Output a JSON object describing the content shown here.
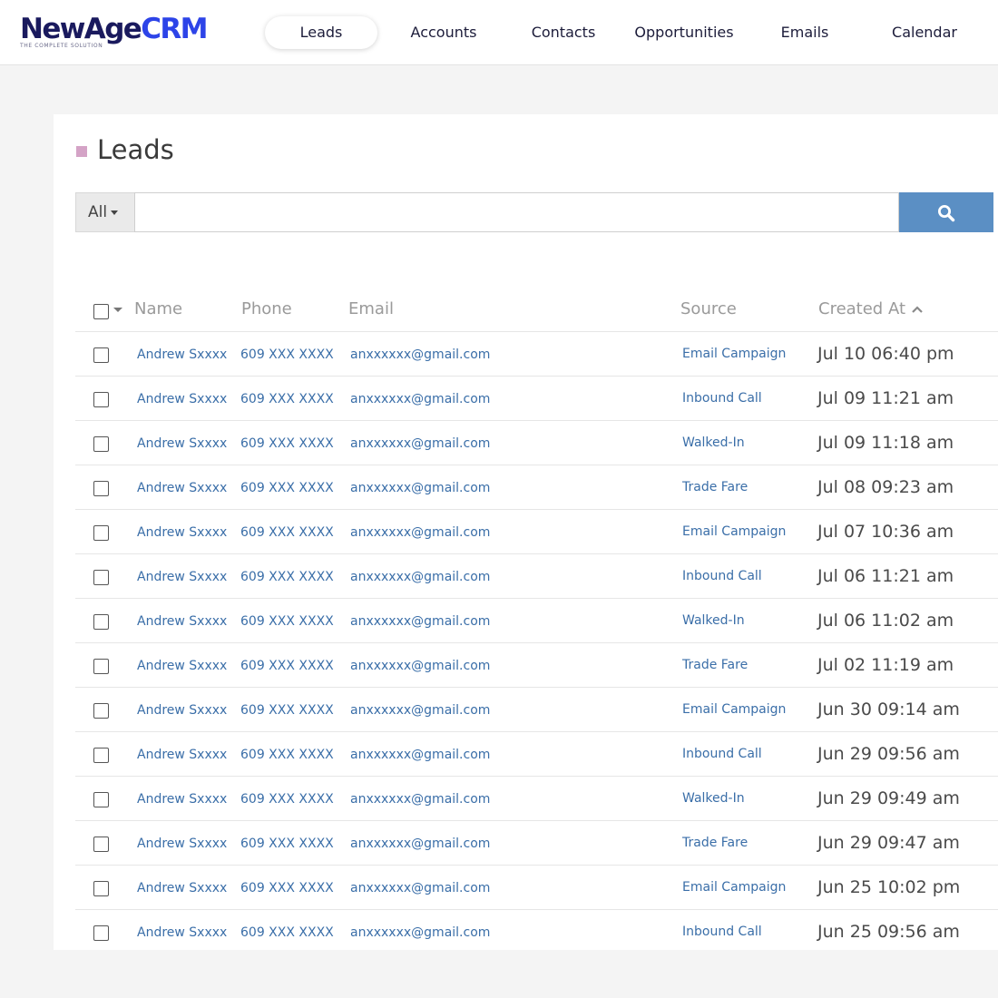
{
  "logo": {
    "part1": "NewAge",
    "part2": "CRM",
    "tagline": "THE COMPLETE SOLUTION"
  },
  "nav": [
    {
      "label": "Leads",
      "active": true
    },
    {
      "label": "Accounts",
      "active": false
    },
    {
      "label": "Contacts",
      "active": false
    },
    {
      "label": "Opportunities",
      "active": false
    },
    {
      "label": "Emails",
      "active": false
    },
    {
      "label": "Calendar",
      "active": false
    }
  ],
  "page": {
    "title": "Leads"
  },
  "search": {
    "filter_label": "All",
    "value": "",
    "placeholder": "",
    "button_icon": "search-icon"
  },
  "table": {
    "headers": {
      "name": "Name",
      "phone": "Phone",
      "email": "Email",
      "source": "Source",
      "created_at": "Created At"
    },
    "sort": {
      "column": "created_at",
      "direction": "asc",
      "icon": "chevron-up-icon"
    },
    "rows": [
      {
        "name": "Andrew Sxxxx",
        "phone": "609 XXX XXXX",
        "email": "anxxxxxx@gmail.com",
        "source": "Email Campaign",
        "created_at": "Jul 10 06:40 pm"
      },
      {
        "name": "Andrew Sxxxx",
        "phone": "609 XXX XXXX",
        "email": "anxxxxxx@gmail.com",
        "source": "Inbound Call",
        "created_at": "Jul 09 11:21 am"
      },
      {
        "name": "Andrew Sxxxx",
        "phone": "609 XXX XXXX",
        "email": "anxxxxxx@gmail.com",
        "source": "Walked-In",
        "created_at": "Jul 09 11:18 am"
      },
      {
        "name": "Andrew Sxxxx",
        "phone": "609 XXX XXXX",
        "email": "anxxxxxx@gmail.com",
        "source": "Trade Fare",
        "created_at": "Jul 08 09:23 am"
      },
      {
        "name": "Andrew Sxxxx",
        "phone": "609 XXX XXXX",
        "email": "anxxxxxx@gmail.com",
        "source": "Email Campaign",
        "created_at": "Jul 07 10:36 am"
      },
      {
        "name": "Andrew Sxxxx",
        "phone": "609 XXX XXXX",
        "email": "anxxxxxx@gmail.com",
        "source": "Inbound Call",
        "created_at": "Jul 06 11:21 am"
      },
      {
        "name": "Andrew Sxxxx",
        "phone": "609 XXX XXXX",
        "email": "anxxxxxx@gmail.com",
        "source": "Walked-In",
        "created_at": "Jul 06 11:02 am"
      },
      {
        "name": "Andrew Sxxxx",
        "phone": "609 XXX XXXX",
        "email": "anxxxxxx@gmail.com",
        "source": "Trade Fare",
        "created_at": "Jul 02 11:19 am"
      },
      {
        "name": "Andrew Sxxxx",
        "phone": "609 XXX XXXX",
        "email": "anxxxxxx@gmail.com",
        "source": "Email Campaign",
        "created_at": "Jun 30 09:14 am"
      },
      {
        "name": "Andrew Sxxxx",
        "phone": "609 XXX XXXX",
        "email": "anxxxxxx@gmail.com",
        "source": "Inbound Call",
        "created_at": "Jun 29 09:56 am"
      },
      {
        "name": "Andrew Sxxxx",
        "phone": "609 XXX XXXX",
        "email": "anxxxxxx@gmail.com",
        "source": "Walked-In",
        "created_at": "Jun 29 09:49 am"
      },
      {
        "name": "Andrew Sxxxx",
        "phone": "609 XXX XXXX",
        "email": "anxxxxxx@gmail.com",
        "source": "Trade Fare",
        "created_at": "Jun 29 09:47 am"
      },
      {
        "name": "Andrew Sxxxx",
        "phone": "609 XXX XXXX",
        "email": "anxxxxxx@gmail.com",
        "source": "Email Campaign",
        "created_at": "Jun 25 10:02 pm"
      },
      {
        "name": "Andrew Sxxxx",
        "phone": "609 XXX XXXX",
        "email": "anxxxxxx@gmail.com",
        "source": "Inbound Call",
        "created_at": "Jun 25 09:56 am"
      }
    ]
  },
  "colors": {
    "brand_dark": "#1a1a5e",
    "brand_blue": "#2d44e8",
    "link": "#3a6ea8",
    "search_button": "#5b8fc4",
    "title_marker": "#d4a3c6"
  }
}
